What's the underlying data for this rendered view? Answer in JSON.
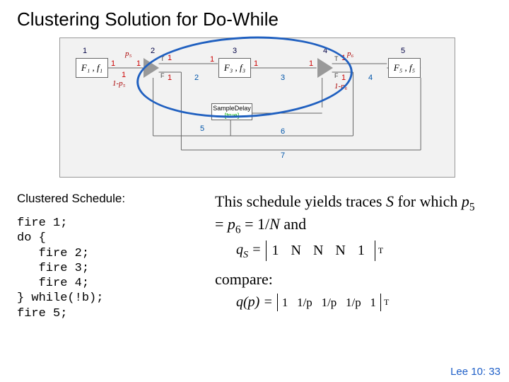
{
  "title": "Clustering Solution for Do-While",
  "diagram": {
    "nodes": {
      "n1": {
        "num": "1",
        "label": "F₁ , f₁"
      },
      "n2": {
        "num": "2"
      },
      "n3": {
        "num": "3",
        "label": "F₃ , f₃"
      },
      "n4": {
        "num": "4"
      },
      "n5": {
        "num": "5",
        "label": "F₅ , f₅"
      },
      "sdLabel": "SampleDelay",
      "sdTrue": "{true}"
    },
    "edgeNums": {
      "e12a": "1",
      "e12b": "1",
      "e2t": "1",
      "e2f": "1",
      "e23a": "1",
      "e23b": "2",
      "e34a": "1",
      "e34b": "3",
      "e4t": "1",
      "e4f": "1",
      "e45": "4",
      "ebot5": "5",
      "ebot6": "6",
      "ebot7": "7",
      "left1": "1"
    },
    "probs": {
      "p5": "p₅",
      "omp5": "1-p₅",
      "p6": "p₆",
      "omp6": "1-p₆"
    },
    "tf": {
      "T": "T",
      "F": "F"
    }
  },
  "schedule": {
    "heading": "Clustered Schedule:",
    "code": "fire 1;\ndo {\n   fire 2;\n   fire 3;\n   fire 4;\n} while(!b);\nfire 5;"
  },
  "explain": {
    "line1a": "This schedule yields traces ",
    "line1b_S": "S",
    "line1c": " for which ",
    "p5": "p",
    "s5": "5",
    "eq": " = ",
    "p6": "p",
    "s6": "6",
    "eq2": " = 1/",
    "N": "N",
    "and": " and",
    "qS": "q",
    "qSsub": "S",
    "vec1": "1  N  N  N  1",
    "compare": "compare:",
    "qp": "q(p)",
    "vec2_1": "1",
    "vec2_2": "1/p",
    "vec2_3": "1/p",
    "vec2_4": "1/p",
    "vec2_5": "1"
  },
  "footer": "Lee 10: 33"
}
